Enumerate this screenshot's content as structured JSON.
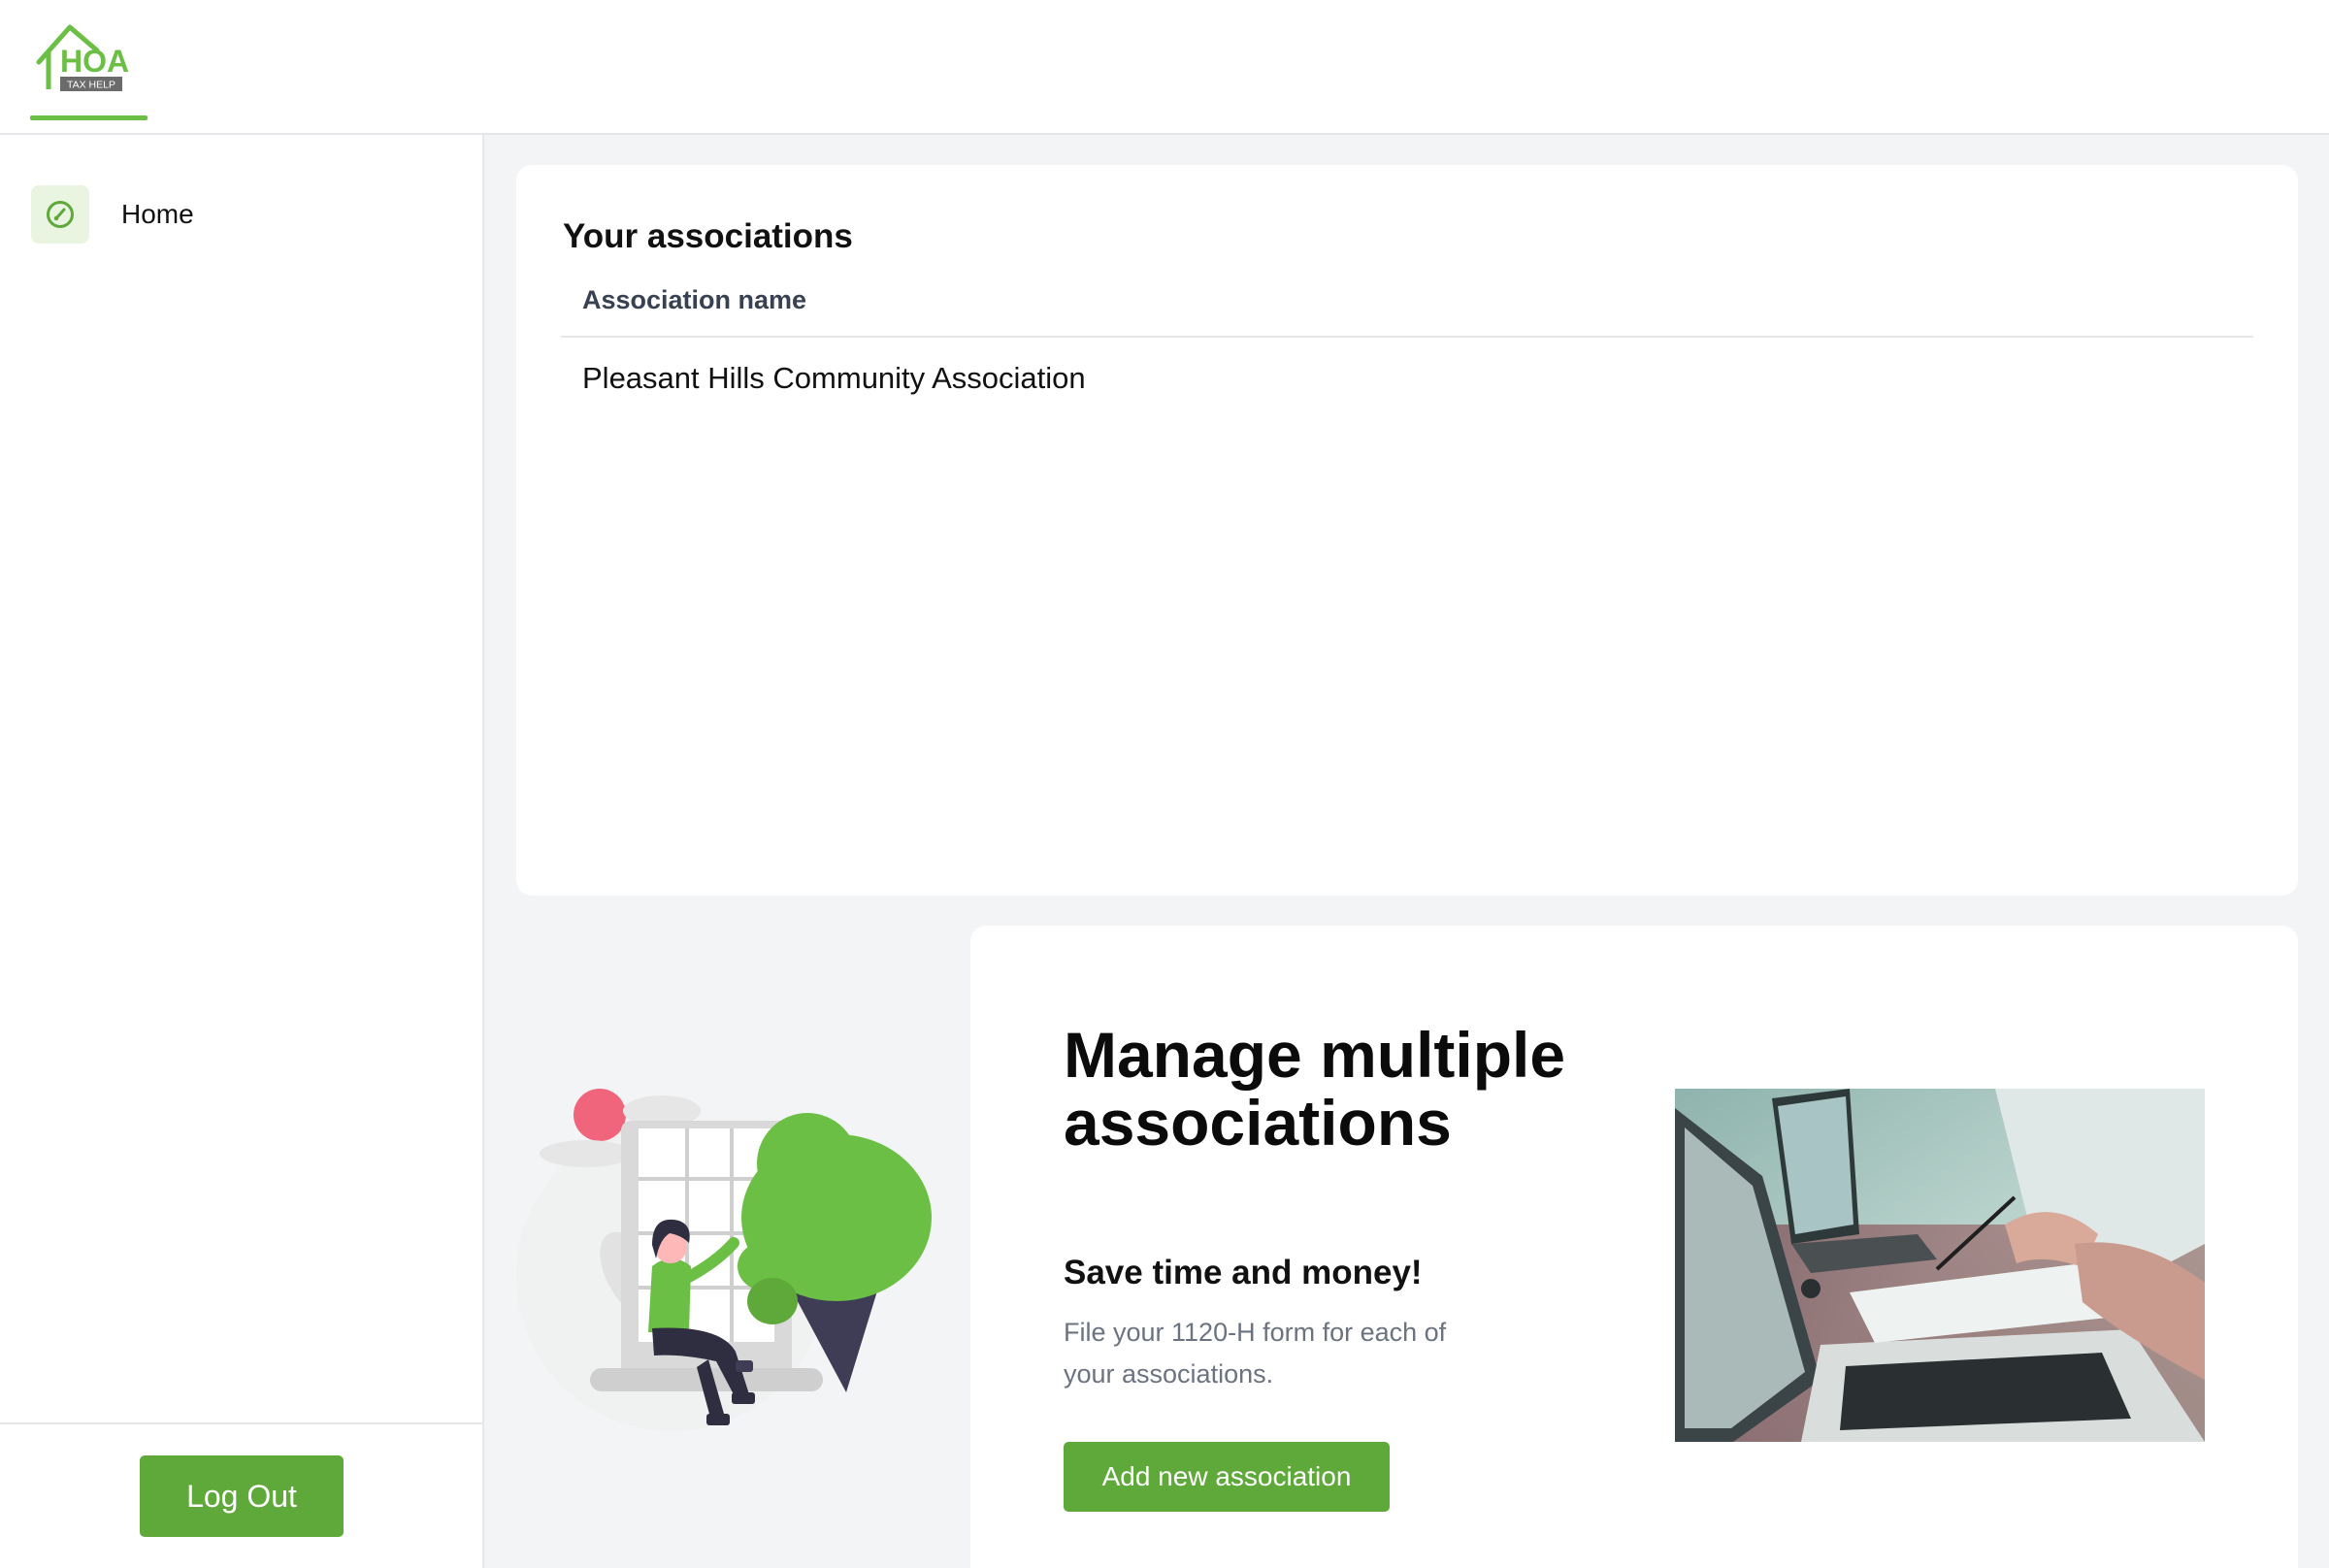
{
  "brand": {
    "logo_main": "HOA",
    "logo_sub": "TAX HELP",
    "accent": "#6bbf44",
    "button_color": "#5fa83a"
  },
  "sidebar": {
    "items": [
      {
        "label": "Home",
        "icon": "dashboard-gauge-icon"
      }
    ],
    "logout_label": "Log Out"
  },
  "associations": {
    "title": "Your associations",
    "columns": [
      "Association name"
    ],
    "rows": [
      {
        "name": "Pleasant Hills Community Association"
      }
    ]
  },
  "promo": {
    "title": "Manage multiple associations",
    "subtitle": "Save time and money!",
    "description": "File your 1120-H form for each of your associations.",
    "button_label": "Add new association"
  }
}
